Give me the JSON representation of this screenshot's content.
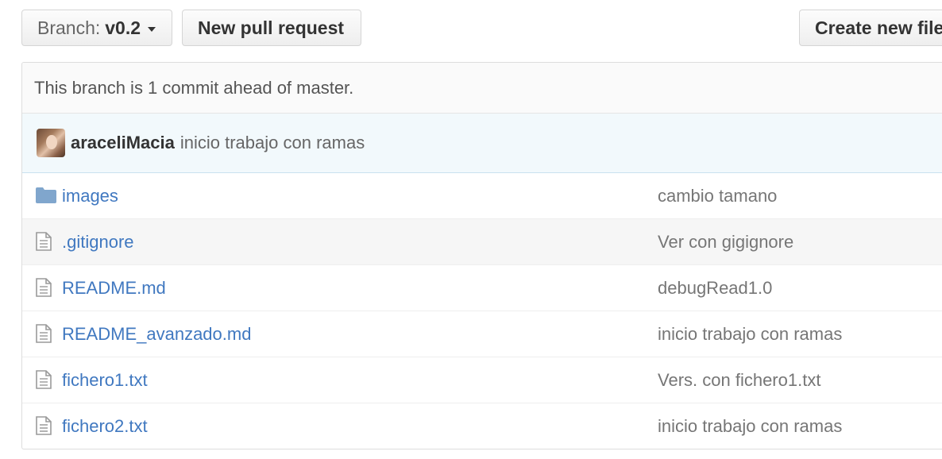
{
  "toolbar": {
    "branch_prefix": "Branch:",
    "branch_value": "v0.2",
    "new_pull_request": "New pull request",
    "create_new_file": "Create new file"
  },
  "branch_info": "This branch is 1 commit ahead of master.",
  "latest_commit": {
    "author": "araceliMacia",
    "message": "inicio trabajo con ramas"
  },
  "files": [
    {
      "icon": "folder-icon",
      "name": "images",
      "message": "cambio tamano"
    },
    {
      "icon": "file-icon",
      "name": ".gitignore",
      "message": "Ver con gigignore"
    },
    {
      "icon": "file-icon",
      "name": "README.md",
      "message": "debugRead1.0"
    },
    {
      "icon": "file-icon",
      "name": "README_avanzado.md",
      "message": "inicio trabajo con ramas"
    },
    {
      "icon": "file-icon",
      "name": "fichero1.txt",
      "message": "Vers. con fichero1.txt"
    },
    {
      "icon": "file-icon",
      "name": "fichero2.txt",
      "message": "inicio trabajo con ramas"
    }
  ],
  "colors": {
    "link": "#4078c0",
    "folder": "#80a6cd",
    "commit_bg": "#f2f9fc"
  }
}
